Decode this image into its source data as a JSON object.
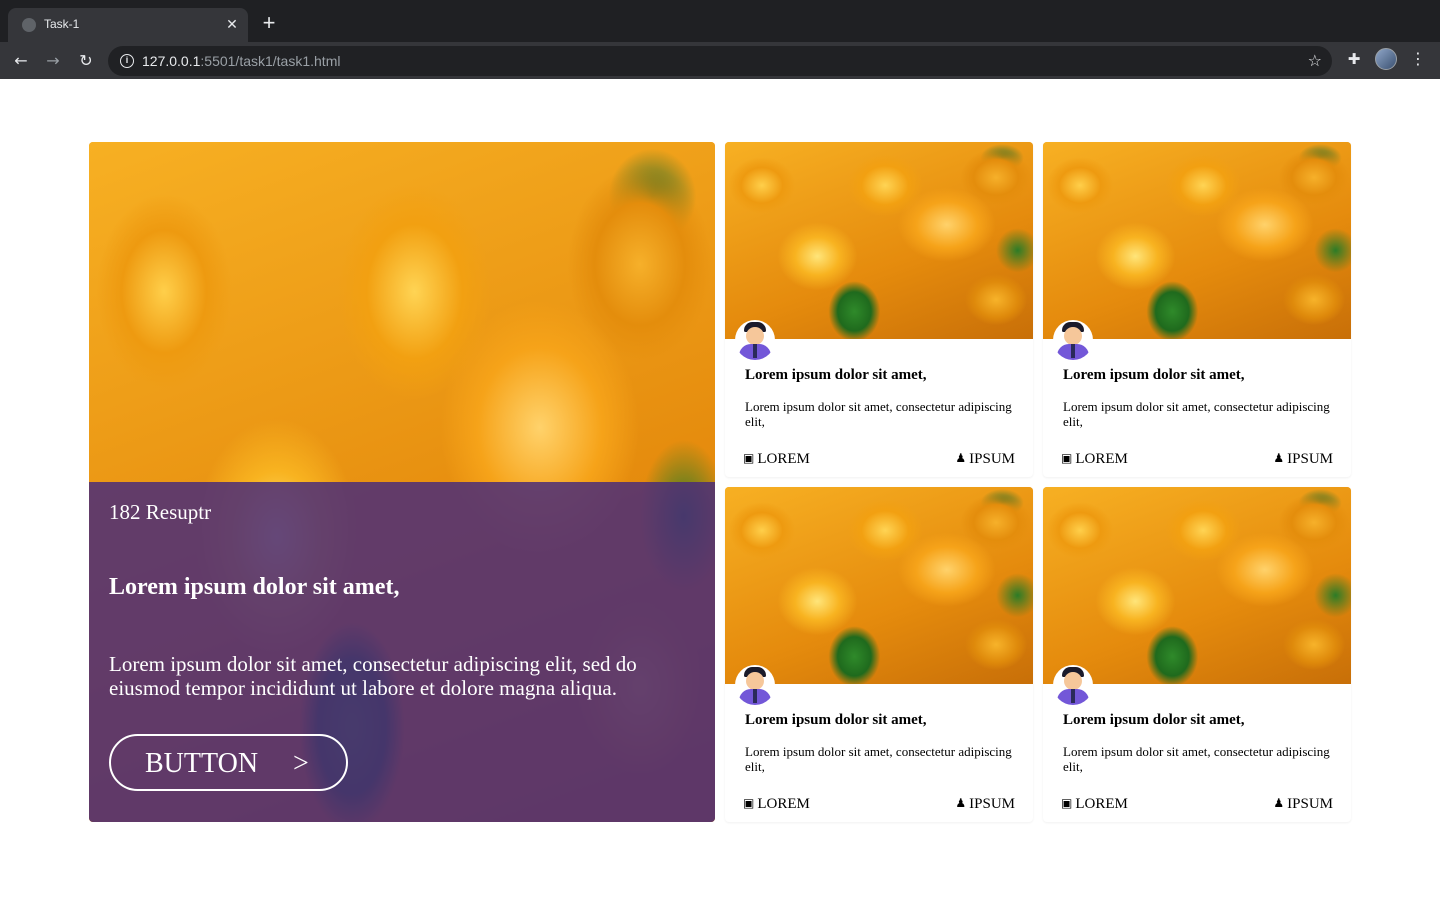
{
  "browser": {
    "tab_title": "Task-1",
    "tab_close": "✕",
    "new_tab": "+",
    "url_host": "127.0.0.1",
    "url_rest": ":5501/task1/task1.html"
  },
  "hero": {
    "count": "182 Resuptr",
    "title": "Lorem ipsum dolor sit amet,",
    "text": "Lorem ipsum dolor sit amet, consectetur adipiscing elit, sed do eiusmod tempor incididunt ut labore et dolore magna aliqua.",
    "button_label": "BUTTON",
    "button_arrow": ">"
  },
  "cards": [
    {
      "title": "Lorem ipsum dolor sit amet,",
      "text": "Lorem ipsum dolor sit amet, consectetur adipiscing elit,",
      "left_label": "LOREM",
      "right_label": "IPSUM"
    },
    {
      "title": "Lorem ipsum dolor sit amet,",
      "text": "Lorem ipsum dolor sit amet, consectetur adipiscing elit,",
      "left_label": "LOREM",
      "right_label": "IPSUM"
    },
    {
      "title": "Lorem ipsum dolor sit amet,",
      "text": "Lorem ipsum dolor sit amet, consectetur adipiscing elit,",
      "left_label": "LOREM",
      "right_label": "IPSUM"
    },
    {
      "title": "Lorem ipsum dolor sit amet,",
      "text": "Lorem ipsum dolor sit amet, consectetur adipiscing elit,",
      "left_label": "LOREM",
      "right_label": "IPSUM"
    }
  ],
  "icons": {
    "left": "contact-card-icon",
    "right": "person-icon",
    "image": "oranges-photo"
  },
  "colors": {
    "hero_overlay": "#4c2d78",
    "avatar_shirt": "#7357d8"
  }
}
